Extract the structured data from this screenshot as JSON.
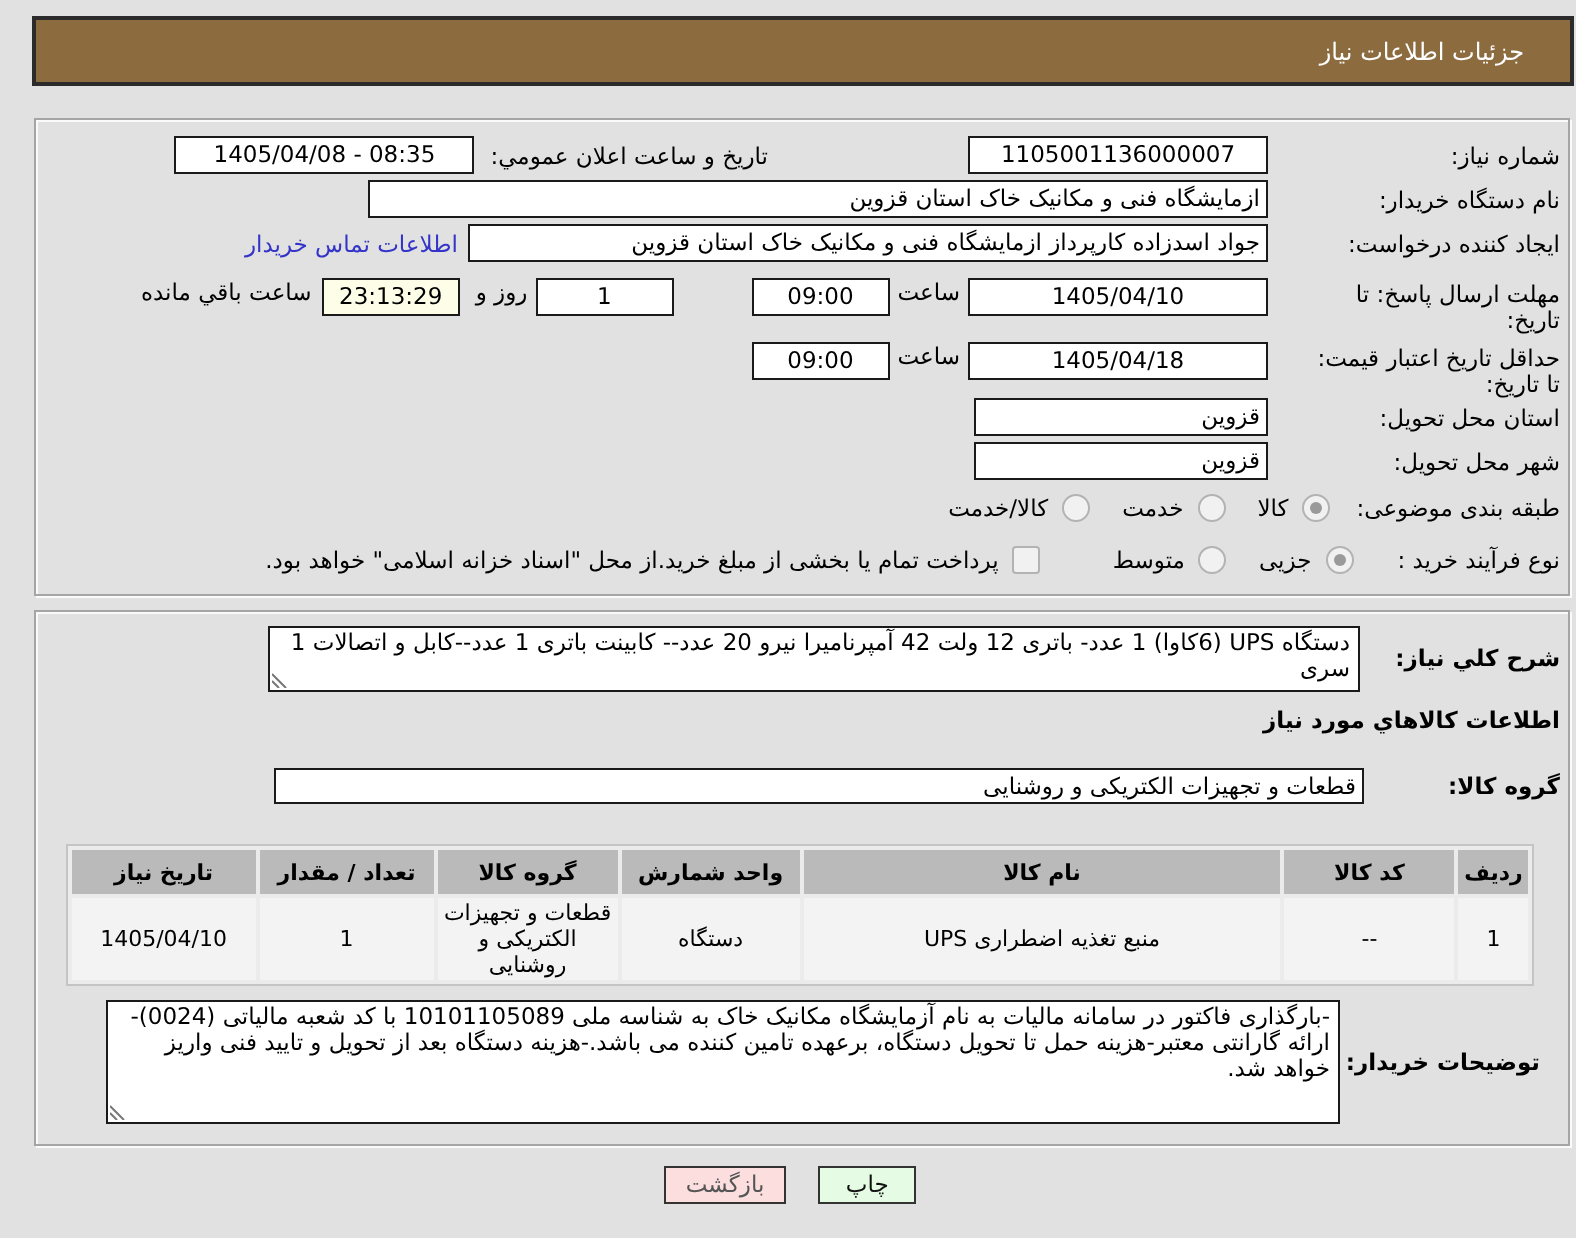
{
  "header": {
    "title": "جزئیات اطلاعات نیاز"
  },
  "details": {
    "need_number": {
      "label": "شماره نیاز:",
      "value": "1105001136000007"
    },
    "announce": {
      "label": "تاریخ و ساعت اعلان عمومي:",
      "value": "1405/04/08 - 08:35"
    },
    "buyer_org": {
      "label": "نام دستگاه خریدار:",
      "value": "ازمایشگاه فنی و مکانیک خاک استان قزوین"
    },
    "requester": {
      "label": "ایجاد کننده درخواست:",
      "value": "جواد اسدزاده کارپرداز ازمایشگاه فنی و مکانیک خاک استان قزوین",
      "link": "اطلاعات تماس خریدار"
    },
    "reply_deadline": {
      "label": "مهلت ارسال پاسخ: تا تاریخ:",
      "date": "1405/04/10",
      "time_label": "ساعت",
      "time": "09:00",
      "days": "1",
      "days_label": "روز و",
      "remaining": "23:13:29",
      "remaining_label": "ساعت باقي مانده"
    },
    "price_validity": {
      "label": "حداقل تاریخ اعتبار قیمت: تا تاریخ:",
      "date": "1405/04/18",
      "time_label": "ساعت",
      "time": "09:00"
    },
    "province": {
      "label": "استان محل تحویل:",
      "value": "قزوین"
    },
    "city": {
      "label": "شهر محل تحویل:",
      "value": "قزوین"
    },
    "category": {
      "label": "طبقه بندی موضوعی:",
      "options": [
        {
          "label": "کالا",
          "selected": true
        },
        {
          "label": "خدمت",
          "selected": false
        },
        {
          "label": "کالا/خدمت",
          "selected": false
        }
      ]
    },
    "purchase_type": {
      "label": "نوع فرآیند خرید :",
      "options": [
        {
          "label": "جزیی",
          "selected": true
        },
        {
          "label": "متوسط",
          "selected": false
        }
      ],
      "treasury": {
        "label": "پرداخت تمام یا بخشی از مبلغ خرید.از محل \"اسناد خزانه اسلامی\" خواهد بود.",
        "checked": false
      }
    }
  },
  "needs": {
    "description_label": "شرح کلي نیاز:",
    "description": "دستگاه UPS (6کاوا) 1 عدد- باتری 12 ولت 42 آمپرنامیرا نیرو 20 عدد-- کابینت باتری 1 عدد--کابل و اتصالات 1 سری",
    "section_title": "اطلاعات کالاهاي مورد نیاز",
    "group_label": "گروه کالا:",
    "group": "قطعات و تجهیزات الکتریکی و روشنایی",
    "table": {
      "columns": [
        "ردیف",
        "کد کالا",
        "نام کالا",
        "واحد شمارش",
        "گروه کالا",
        "تعداد / مقدار",
        "تاریخ نیاز"
      ],
      "rows": [
        [
          "1",
          "--",
          "منبع تغذیه اضطراری UPS",
          "دستگاه",
          "قطعات و تجهیزات الکتریکی و روشنایی",
          "1",
          "1405/04/10"
        ]
      ]
    },
    "notes_label": "توضیحات خریدار:",
    "notes": "-بارگذاری فاکتور در سامانه مالیات به نام آزمایشگاه مکانیک خاک به شناسه ملی 10101105089 با کد شعبه مالیاتی (0024)-ارائه گارانتی معتبر-هزینه حمل تا تحویل دستگاه، برعهده تامین کننده می باشد.-هزینه دستگاه بعد از تحویل و تایید فنی واریز خواهد شد."
  },
  "buttons": [
    {
      "label": "چاپ",
      "kind": "print"
    },
    {
      "label": "بازگشت",
      "kind": "back"
    }
  ]
}
